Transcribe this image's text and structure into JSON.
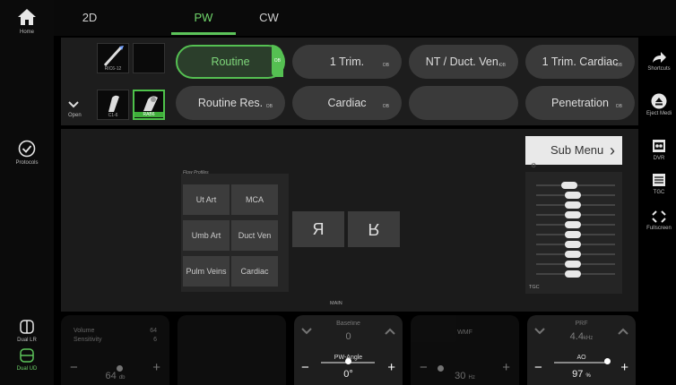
{
  "left_rail": {
    "home_label": "Home",
    "protocols_label": "Protocols",
    "dual_lr_label": "Dual LR",
    "dual_ud_label": "Dual UD"
  },
  "right_rail": {
    "shortcuts_label": "Shortcuts",
    "eject_label": "Eject Medi",
    "dvr_label": "DVR",
    "tgc_label": "TGC",
    "fullscreen_label": "Fullscreen"
  },
  "tabs": [
    {
      "label": "2D"
    },
    {
      "label": "PW"
    },
    {
      "label": "CW"
    }
  ],
  "probes": [
    {
      "label": "RIC6-12"
    },
    {
      "label": ""
    },
    {
      "label": "C1-6"
    },
    {
      "label": "RAB6"
    }
  ],
  "open_label": "Open",
  "presets": [
    {
      "label": "Routine",
      "tag": "OB"
    },
    {
      "label": "1 Trim.",
      "tag": "OB"
    },
    {
      "label": "NT / Duct. Ven.",
      "tag": "OB"
    },
    {
      "label": "1 Trim. Cardiac",
      "tag": "OB"
    },
    {
      "label": "Routine Res.",
      "tag": "OB"
    },
    {
      "label": "Cardiac",
      "tag": "OB"
    },
    {
      "label": ""
    },
    {
      "label": "Penetration",
      "tag": "OB"
    }
  ],
  "flow_profiles": {
    "title": "Flow Profiles",
    "items": [
      {
        "label": "Ut Art"
      },
      {
        "label": "MCA"
      },
      {
        "label": "Umb Art"
      },
      {
        "label": "Duct Ven"
      },
      {
        "label": "Pulm Veins"
      },
      {
        "label": "Cardiac"
      }
    ]
  },
  "flip": {
    "left": "Я",
    "right": "R"
  },
  "main_label": "MAIN",
  "submenu_label": "Sub Menu",
  "tgc_label": "TGC",
  "tgc_levels": [
    0.4,
    0.45,
    0.45,
    0.45,
    0.45,
    0.45,
    0.45,
    0.45,
    0.45,
    0.45
  ],
  "knobs": [
    {
      "title": "Volume",
      "title2": "Sensitivity",
      "side1": "64",
      "side2": "6",
      "value": "64",
      "unit": "db",
      "dimmed": true
    },
    {
      "title": "",
      "value": "",
      "dimmed": true
    },
    {
      "title": "Baseline",
      "value": "0",
      "sub_title": "PW-Angle",
      "sub_value": "0°",
      "dimmed": false
    },
    {
      "title": "WMF",
      "value": "30",
      "unit": "Hz",
      "dimmed": true
    },
    {
      "title": "PRF",
      "value": "4.4",
      "unit": "kHz",
      "sub_title": "AO",
      "sub_value": "97",
      "sub_unit": "%",
      "dimmed": false
    }
  ],
  "colors": {
    "accent": "#55c052"
  }
}
